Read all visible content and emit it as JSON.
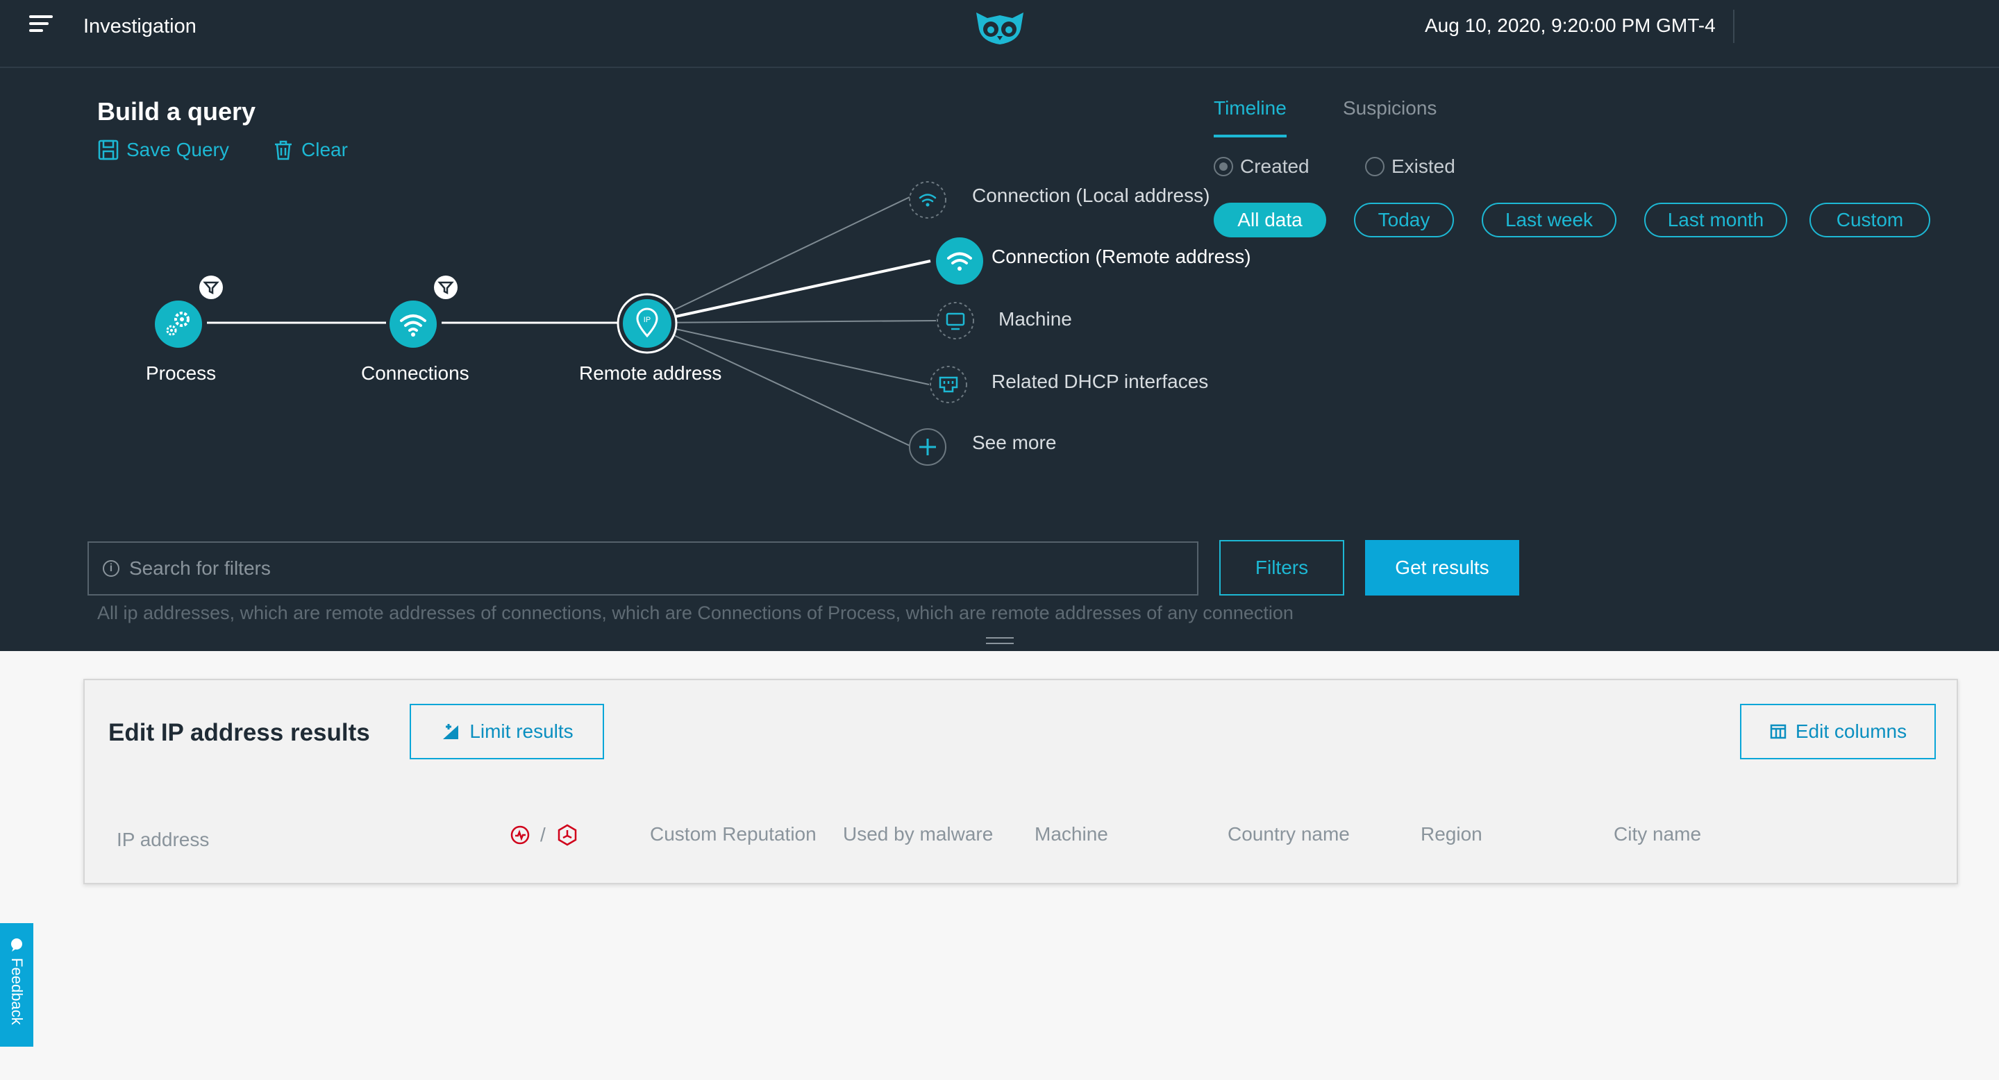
{
  "header": {
    "title": "Investigation",
    "datetime": "Aug 10, 2020, 9:20:00 PM GMT-4"
  },
  "query": {
    "title": "Build a query",
    "save_label": "Save Query",
    "clear_label": "Clear"
  },
  "graph": {
    "nodes": [
      {
        "label": "Process",
        "icon": "gears-icon",
        "has_filter": true
      },
      {
        "label": "Connections",
        "icon": "wifi-icon",
        "has_filter": true
      },
      {
        "label": "Remote address",
        "icon": "ip-pin-icon",
        "selected": true
      }
    ],
    "branches": [
      {
        "label": "Connection (Local address)",
        "icon": "wifi-icon"
      },
      {
        "label": "Connection (Remote address)",
        "icon": "wifi-icon",
        "active": true
      },
      {
        "label": "Machine",
        "icon": "monitor-icon"
      },
      {
        "label": "Related DHCP interfaces",
        "icon": "network-port-icon"
      },
      {
        "label": "See more",
        "icon": "plus-icon"
      }
    ]
  },
  "timeline": {
    "tabs": [
      {
        "label": "Timeline",
        "active": true
      },
      {
        "label": "Suspicions",
        "active": false
      }
    ],
    "radios": [
      {
        "label": "Created",
        "checked": true
      },
      {
        "label": "Existed",
        "checked": false
      }
    ],
    "ranges": [
      {
        "label": "All data",
        "active": true
      },
      {
        "label": "Today"
      },
      {
        "label": "Last week"
      },
      {
        "label": "Last month"
      },
      {
        "label": "Custom"
      }
    ]
  },
  "search": {
    "placeholder": "Search for filters",
    "filters_label": "Filters",
    "get_results_label": "Get results",
    "description": "All ip addresses, which are remote addresses of connections, which are Connections of Process, which are remote addresses of any connection"
  },
  "results": {
    "title": "Edit IP address results",
    "limit_label": "Limit results",
    "edit_columns_label": "Edit columns",
    "columns": [
      "IP address",
      "Custom Reputation",
      "Used by malware",
      "Machine",
      "Country name",
      "Region",
      "City name"
    ],
    "separator": "/"
  },
  "feedback": {
    "label": "Feedback"
  },
  "colors": {
    "accent": "#1db8d4",
    "node": "#12b5c5",
    "dark_bg": "#1f2b35",
    "primary_button": "#0aa6d8",
    "danger": "#d0021b"
  }
}
